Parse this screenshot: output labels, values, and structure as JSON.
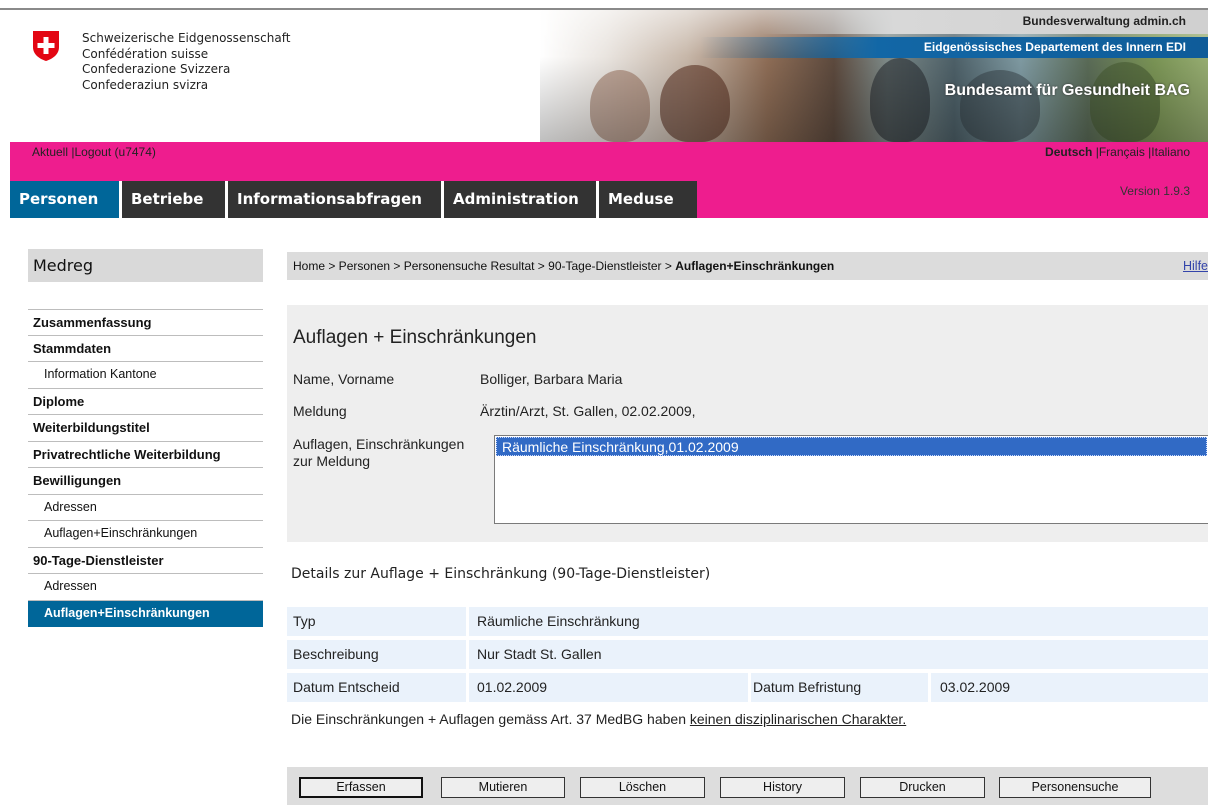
{
  "header": {
    "confederation_names": [
      "Schweizerische Eidgenossenschaft",
      "Confédération suisse",
      "Confederazione Svizzera",
      "Confederaziun svizra"
    ],
    "admin_link": "Bundesverwaltung admin.ch",
    "department": "Eidgenössisches Departement des Innern EDI",
    "office": "Bundesamt für Gesundheit BAG"
  },
  "userbar": {
    "aktuell": "Aktuell",
    "logout": "Logout (u7474)",
    "languages": [
      "Deutsch",
      "Français",
      "Italiano"
    ],
    "active_language": "Deutsch",
    "version": "Version 1.9.3"
  },
  "tabs": [
    {
      "label": "Personen",
      "active": true
    },
    {
      "label": "Betriebe",
      "active": false
    },
    {
      "label": "Informationsabfragen",
      "active": false
    },
    {
      "label": "Administration",
      "active": false
    },
    {
      "label": "Meduse",
      "active": false
    }
  ],
  "sidebar": {
    "title": "Medreg",
    "items": [
      {
        "label": "Zusammenfassung",
        "level": 1
      },
      {
        "label": "Stammdaten",
        "level": 1
      },
      {
        "label": "Information Kantone",
        "level": 2
      },
      {
        "label": "Diplome",
        "level": 1
      },
      {
        "label": "Weiterbildungstitel",
        "level": 1
      },
      {
        "label": "Privatrechtliche Weiterbildung",
        "level": 1
      },
      {
        "label": "Bewilligungen",
        "level": 1
      },
      {
        "label": "Adressen",
        "level": 2
      },
      {
        "label": "Auflagen+Einschränkungen",
        "level": 2
      },
      {
        "label": "90-Tage-Dienstleister",
        "level": 1
      },
      {
        "label": "Adressen",
        "level": 2
      },
      {
        "label": "Auflagen+Einschränkungen",
        "level": 2,
        "current": true
      }
    ]
  },
  "breadcrumb": {
    "path": "Home > Personen > Personensuche Resultat > 90-Tage-Dienstleister > ",
    "current": "Auflagen+Einschränkungen",
    "help": "Hilfe"
  },
  "form": {
    "title": "Auflagen + Einschränkungen",
    "name_label": "Name, Vorname",
    "name_value": "Bolliger, Barbara Maria",
    "meldung_label": "Meldung",
    "meldung_value": "Ärztin/Arzt, St. Gallen, 02.02.2009,",
    "auflagen_label_1": "Auflagen, Einschränkungen",
    "auflagen_label_2": "zur Meldung",
    "list_items": [
      "Räumliche Einschränkung,01.02.2009"
    ]
  },
  "details": {
    "title": "Details zur Auflage + Einschränkung (90-Tage-Dienstleister)",
    "typ_label": "Typ",
    "typ_value": "Räumliche Einschränkung",
    "beschreibung_label": "Beschreibung",
    "beschreibung_value": "Nur Stadt St. Gallen",
    "entscheid_label": "Datum Entscheid",
    "entscheid_value": "01.02.2009",
    "befristung_label": "Datum Befristung",
    "befristung_value": "03.02.2009",
    "note_text": "Die Einschränkungen + Auflagen gemäss Art. 37 MedBG haben ",
    "note_link": "keinen disziplinarischen Charakter."
  },
  "buttons": {
    "erfassen": "Erfassen",
    "mutieren": "Mutieren",
    "loeschen": "Löschen",
    "history": "History",
    "drucken": "Drucken",
    "personensuche": "Personensuche"
  },
  "colors": {
    "magenta": "#ee1d8e",
    "active_blue": "#006699",
    "tab_dark": "#333333",
    "selection_blue": "#316ac5"
  }
}
